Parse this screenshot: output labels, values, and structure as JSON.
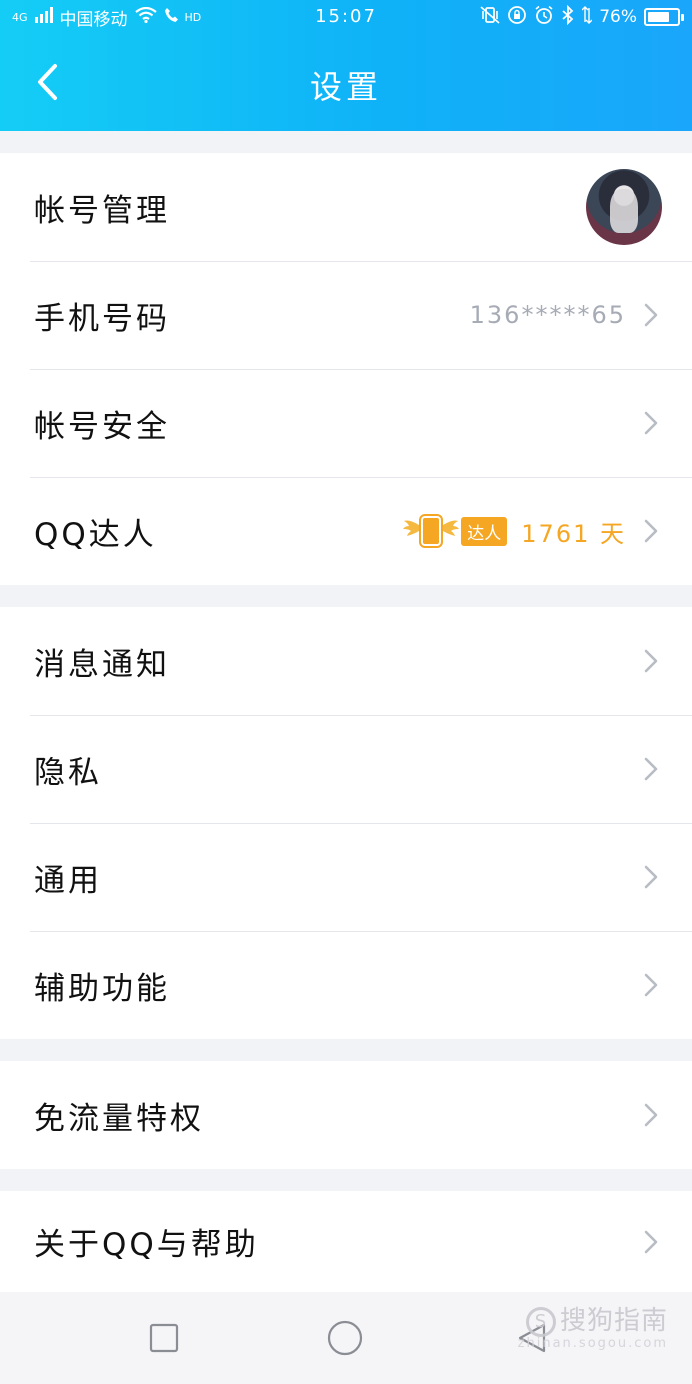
{
  "status_bar": {
    "network_type": "4G",
    "carrier": "中国移动",
    "hd_label": "HD",
    "time": "15:07",
    "battery_percent": "76%",
    "battery_level": 0.76
  },
  "header": {
    "title": "设置"
  },
  "groups": [
    {
      "items": [
        {
          "label": "帐号管理",
          "has_avatar": true
        },
        {
          "label": "手机号码",
          "value": "136*****65"
        },
        {
          "label": "帐号安全"
        },
        {
          "label": "QQ达人",
          "badge_text": "达人",
          "value": "1761 天"
        }
      ]
    },
    {
      "items": [
        {
          "label": "消息通知"
        },
        {
          "label": "隐私"
        },
        {
          "label": "通用"
        },
        {
          "label": "辅助功能"
        }
      ]
    },
    {
      "items": [
        {
          "label": "免流量特权"
        }
      ]
    },
    {
      "items": [
        {
          "label": "关于QQ与帮助"
        }
      ]
    }
  ],
  "watermark": {
    "text": "搜狗指南",
    "subtext": "zhinan.sogou.com"
  },
  "colors": {
    "header_start": "#14cdf6",
    "header_end": "#1aa6fb",
    "accent_orange": "#f5a623",
    "value_gray": "#a7abb5",
    "background": "#f2f3f7"
  }
}
